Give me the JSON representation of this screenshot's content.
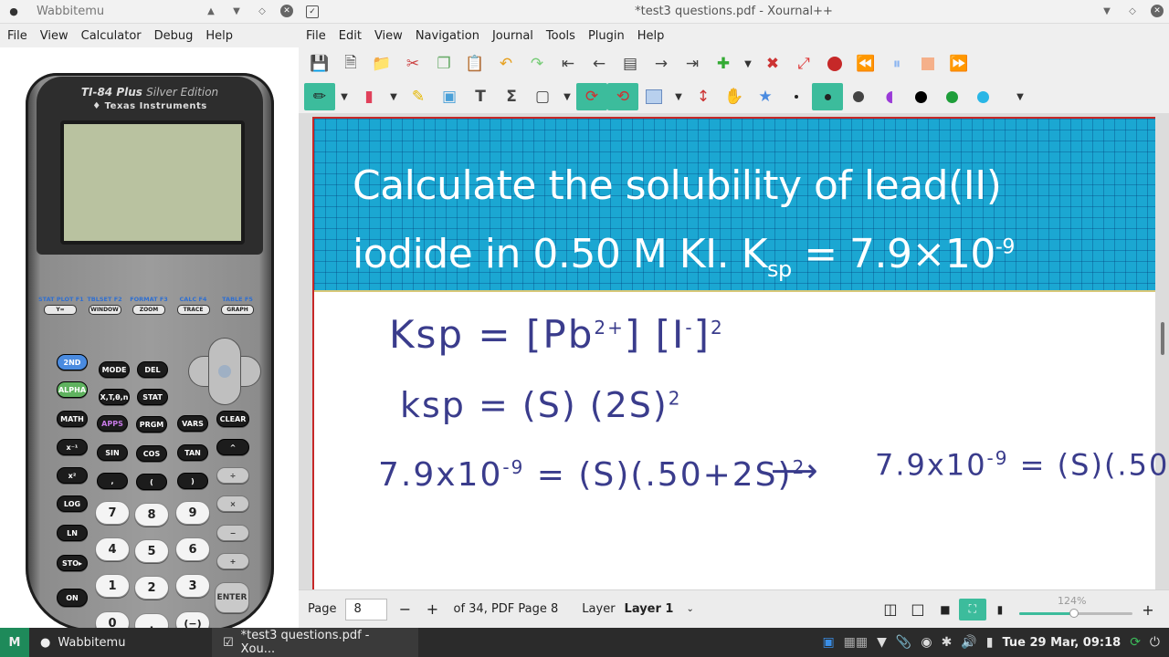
{
  "left_window": {
    "title": "Wabbitemu",
    "menu": [
      "File",
      "View",
      "Calculator",
      "Debug",
      "Help"
    ]
  },
  "calculator": {
    "brand": "TI-84 Plus",
    "edition": "Silver Edition",
    "maker": "Texas Instruments",
    "fkeys": [
      {
        "label": "STAT PLOT F1",
        "key": "Y="
      },
      {
        "label": "TBLSET F2",
        "key": "WINDOW"
      },
      {
        "label": "FORMAT F3",
        "key": "ZOOM"
      },
      {
        "label": "CALC F4",
        "key": "TRACE"
      },
      {
        "label": "TABLE F5",
        "key": "GRAPH"
      }
    ],
    "keys": {
      "second": "2ND",
      "mode": "MODE",
      "del": "DEL",
      "alpha": "ALPHA",
      "xt": "X,T,θ,n",
      "stat": "STAT",
      "math": "MATH",
      "apps": "APPS",
      "prgm": "PRGM",
      "vars": "VARS",
      "clear": "CLEAR",
      "inv": "x⁻¹",
      "sin": "SIN",
      "cos": "COS",
      "tan": "TAN",
      "pow": "^",
      "sq": "x²",
      "comma": ",",
      "lparen": "(",
      "rparen": ")",
      "div": "÷",
      "log": "LOG",
      "n7": "7",
      "n8": "8",
      "n9": "9",
      "mul": "×",
      "ln": "LN",
      "n4": "4",
      "n5": "5",
      "n6": "6",
      "minus": "−",
      "sto": "STO▸",
      "n1": "1",
      "n2": "2",
      "n3": "3",
      "plus": "+",
      "on": "ON",
      "n0": "0",
      "dot": ".",
      "neg": "(−)",
      "enter": "ENTER"
    }
  },
  "right_window": {
    "title": "*test3 questions.pdf - Xournal++",
    "menu": [
      "File",
      "Edit",
      "View",
      "Navigation",
      "Journal",
      "Tools",
      "Plugin",
      "Help"
    ]
  },
  "toolbar1_icons": [
    "save-icon",
    "new-icon",
    "open-icon",
    "cut-icon",
    "copy-icon",
    "paste-icon",
    "undo-icon",
    "redo-icon",
    "first-page-icon",
    "prev-page-icon",
    "goto-page-icon",
    "next-page-icon",
    "last-page-icon",
    "new-page-icon",
    "delete-page-icon",
    "fullscreen-icon",
    "record-icon",
    "rewind-icon",
    "pause-icon",
    "stop-icon",
    "fast-forward-icon"
  ],
  "colors": {
    "accent": "#3cbc9c",
    "banner": "#1ba7d2",
    "ink": "#3a3c8c",
    "palette": [
      "#000000",
      "#1e9e3a",
      "#29b6e6"
    ]
  },
  "document": {
    "question_line1": "Calculate the solubility of lead(II)",
    "question_line2_a": "iodide in 0.50 M KI. K",
    "question_line2_sub": "sp",
    "question_line2_b": " = 7.9×10",
    "question_line2_sup": "-9",
    "handwriting": {
      "l1": "Ksp = [Pb",
      "l1_sup": "2+",
      "l1_b": "] [I",
      "l1_sup2": "-",
      "l1_c": "]",
      "l1_sup3": "2",
      "l2": "ksp = (S) (2S)",
      "l2_sup": "2",
      "l3": "7.9x10",
      "l3_sup": "-9",
      "l3_b": " = (S)(.50+2S)",
      "l3_sup2": "2",
      "arrow": "⟶",
      "l4": "7.9x10",
      "l4_sup": "-9",
      "l4_b": " = (S)(.50"
    }
  },
  "status": {
    "page_label": "Page",
    "page_value": "8",
    "page_of": "of 34, PDF Page 8",
    "layer_label": "Layer",
    "layer_value": "Layer 1",
    "zoom": "124%",
    "zoom_fraction": 0.48
  },
  "taskbar": {
    "task1": "Wabbitemu",
    "task2": "*test3 questions.pdf - Xou...",
    "clock": "Tue 29 Mar, 09:18"
  }
}
